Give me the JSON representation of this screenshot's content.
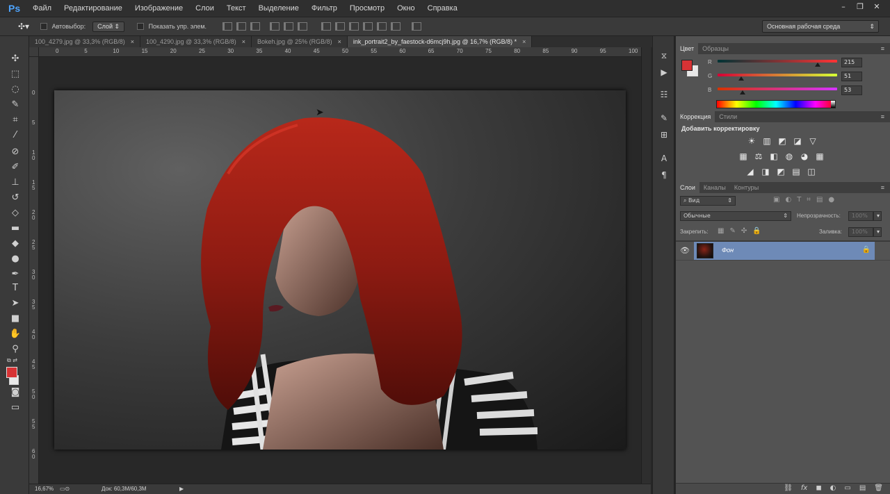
{
  "app": {
    "logo": "Ps"
  },
  "menu": [
    "Файл",
    "Редактирование",
    "Изображение",
    "Слои",
    "Текст",
    "Выделение",
    "Фильтр",
    "Просмотр",
    "Окно",
    "Справка"
  ],
  "window_controls": [
    "–",
    "❐",
    "✕"
  ],
  "options": {
    "autoselect_label": "Автовыбор:",
    "autoselect_value": "Слой",
    "show_transform_label": "Показать упр. элем.",
    "workspace": "Основная рабочая среда"
  },
  "tabs": [
    {
      "label": "100_4279.jpg @ 33,3% (RGB/8)",
      "close": "×"
    },
    {
      "label": "100_4290.jpg @ 33,3% (RGB/8)",
      "close": "×"
    },
    {
      "label": "Bokeh.jpg @ 25% (RGB/8)",
      "close": "×"
    },
    {
      "label": "ink_portrait2_by_faestock-d6mcj9h.jpg @ 16,7% (RGB/8) *",
      "close": "×"
    }
  ],
  "ruler": {
    "h": [
      "0",
      "5",
      "10",
      "15",
      "20",
      "25",
      "30",
      "35",
      "40",
      "45",
      "50",
      "55",
      "60",
      "65",
      "70",
      "75",
      "80",
      "85",
      "90",
      "95",
      "100"
    ],
    "v": [
      "0",
      "5",
      "1 0",
      "1 5",
      "2 0",
      "2 5",
      "3 0",
      "3 5",
      "4 0",
      "4 5",
      "5 0",
      "5 5",
      "6 0"
    ]
  },
  "status": {
    "zoom": "16,67%",
    "doc": "Док: 60,3M/60,3M"
  },
  "color_panel": {
    "tabs": [
      "Цвет",
      "Образцы"
    ],
    "menu": "≡",
    "fg_color": "#d73335",
    "bg_color": "#e8e8e8",
    "channels": [
      {
        "label": "R",
        "value": "215",
        "level": 0.84
      },
      {
        "label": "G",
        "value": "51",
        "level": 0.2
      },
      {
        "label": "B",
        "value": "53",
        "level": 0.21
      }
    ]
  },
  "adjustments_panel": {
    "tabs": [
      "Коррекция",
      "Стили"
    ],
    "menu": "≡",
    "title": "Добавить корректировку",
    "row1": [
      "☀",
      "▥",
      "◩",
      "◪",
      "▽"
    ],
    "row2": [
      "▦",
      "⚖",
      "◧",
      "◍",
      "◕",
      "▦"
    ],
    "row3": [
      "◢",
      "◨",
      "◩",
      "▤",
      "◫"
    ]
  },
  "layers_panel": {
    "tabs": [
      "Слои",
      "Каналы",
      "Контуры"
    ],
    "menu": "≡",
    "filter_label": "Вид",
    "blend_mode": "Обычные",
    "opacity_label": "Непрозрачность:",
    "opacity_value": "100%",
    "lock_label": "Закрепить:",
    "fill_label": "Заливка:",
    "fill_value": "100%",
    "layers": [
      {
        "name": "Фон"
      }
    ],
    "bottom_icons": [
      "⛓",
      "fx",
      "◼",
      "◐",
      "▭",
      "▤",
      "🗑"
    ]
  },
  "colors": {
    "accent": "#5b87c4",
    "layer_selected": "#6e8ab7"
  }
}
